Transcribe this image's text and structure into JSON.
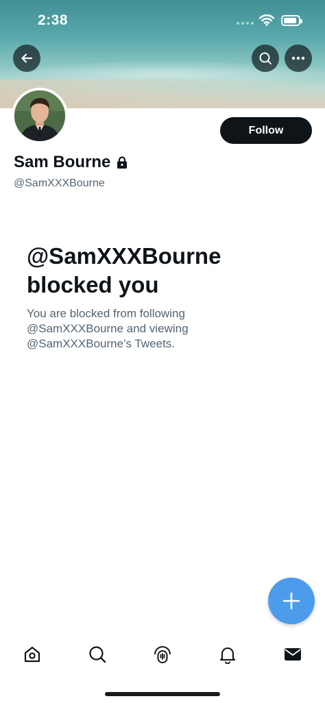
{
  "status_bar": {
    "time": "2:38"
  },
  "header": {
    "back_icon": "arrow-left-icon",
    "search_icon": "search-icon",
    "more_icon": "more-icon"
  },
  "profile": {
    "display_name": "Sam Bourne",
    "handle": "@SamXXXBourne",
    "protected_icon": "lock-icon",
    "follow_label": "Follow"
  },
  "blocked": {
    "title": "@SamXXXBourne blocked you",
    "message": "You are blocked from following @SamXXXBourne and viewing @SamXXXBourne’s Tweets."
  },
  "fab": {
    "icon": "plus-icon"
  },
  "tab_bar": {
    "items": [
      "home-icon",
      "search-icon",
      "spaces-icon",
      "notifications-icon",
      "messages-icon"
    ]
  },
  "colors": {
    "accent": "#4c9ceb",
    "text_primary": "#0f1419",
    "text_secondary": "#536471"
  }
}
